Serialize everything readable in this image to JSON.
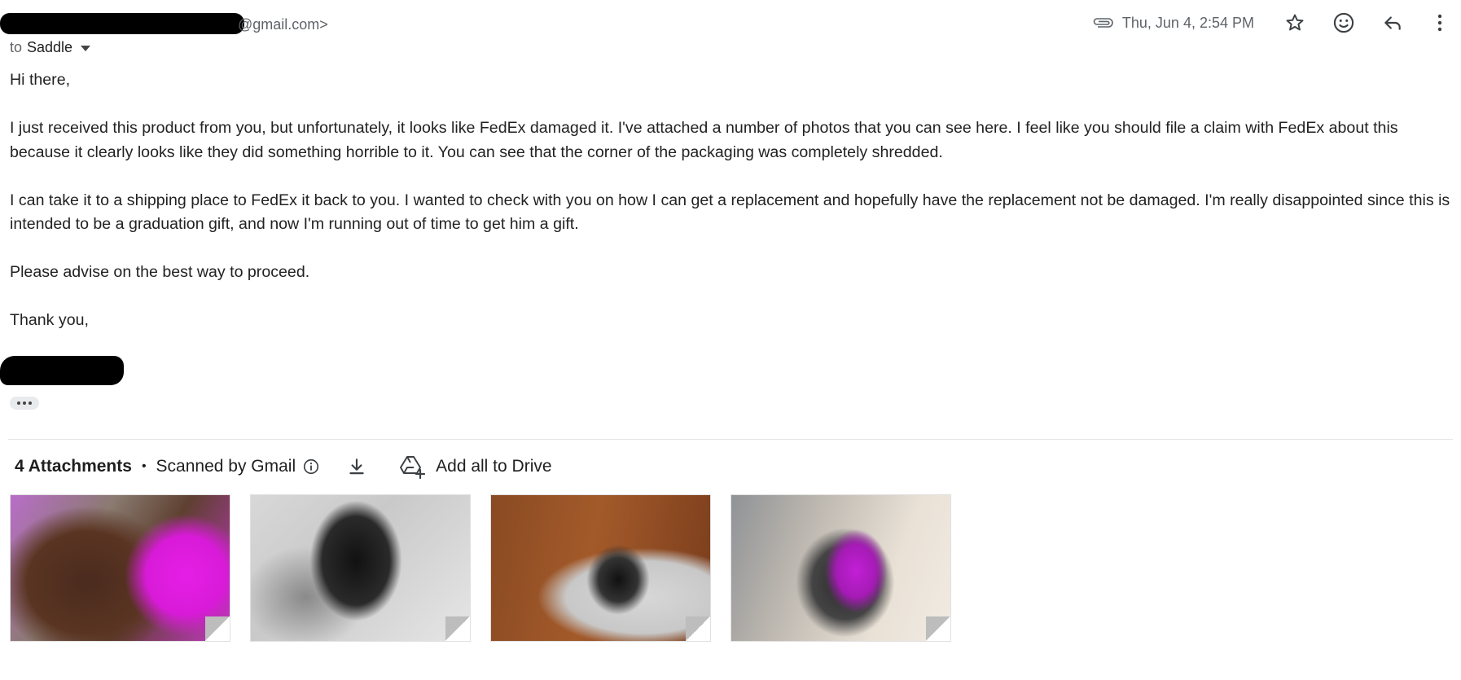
{
  "header": {
    "sender_email_visible": "@gmail.com>",
    "recipient_prefix": "to",
    "recipient_name": "Saddle",
    "date": "Thu, Jun 4, 2:54 PM"
  },
  "icons": {
    "attachment": "paperclip-icon",
    "star": "star-icon",
    "emoji": "emoji-icon",
    "reply": "reply-icon",
    "more": "more-vert-icon",
    "info": "info-icon",
    "download": "download-icon",
    "drive": "drive-add-icon"
  },
  "body": {
    "greeting": "Hi there,",
    "paragraph1": "I just received this product from you, but unfortunately, it looks like FedEx damaged it.  I've attached a number of photos that you can see here. I feel like you should file a claim with FedEx about this because it clearly looks like they did something horrible to it. You can see that the corner of the packaging was completely shredded.",
    "paragraph2": "I can take it to a shipping place to FedEx it back to you. I wanted to check with you on how I can get a replacement and hopefully have the replacement not be damaged. I'm really disappointed since this is intended to be a graduation gift, and now I'm running out of time to get him a gift.",
    "paragraph3": "Please advise on the best way to proceed.",
    "closing": "Thank you,"
  },
  "attachments": {
    "count_label": "4 Attachments",
    "separator": "•",
    "scanned_label": "Scanned by Gmail",
    "add_to_drive_label": "Add all to Drive"
  },
  "colors": {
    "text": "#1f1f1f",
    "muted": "#5f6368",
    "divider": "#e5e5e5"
  }
}
